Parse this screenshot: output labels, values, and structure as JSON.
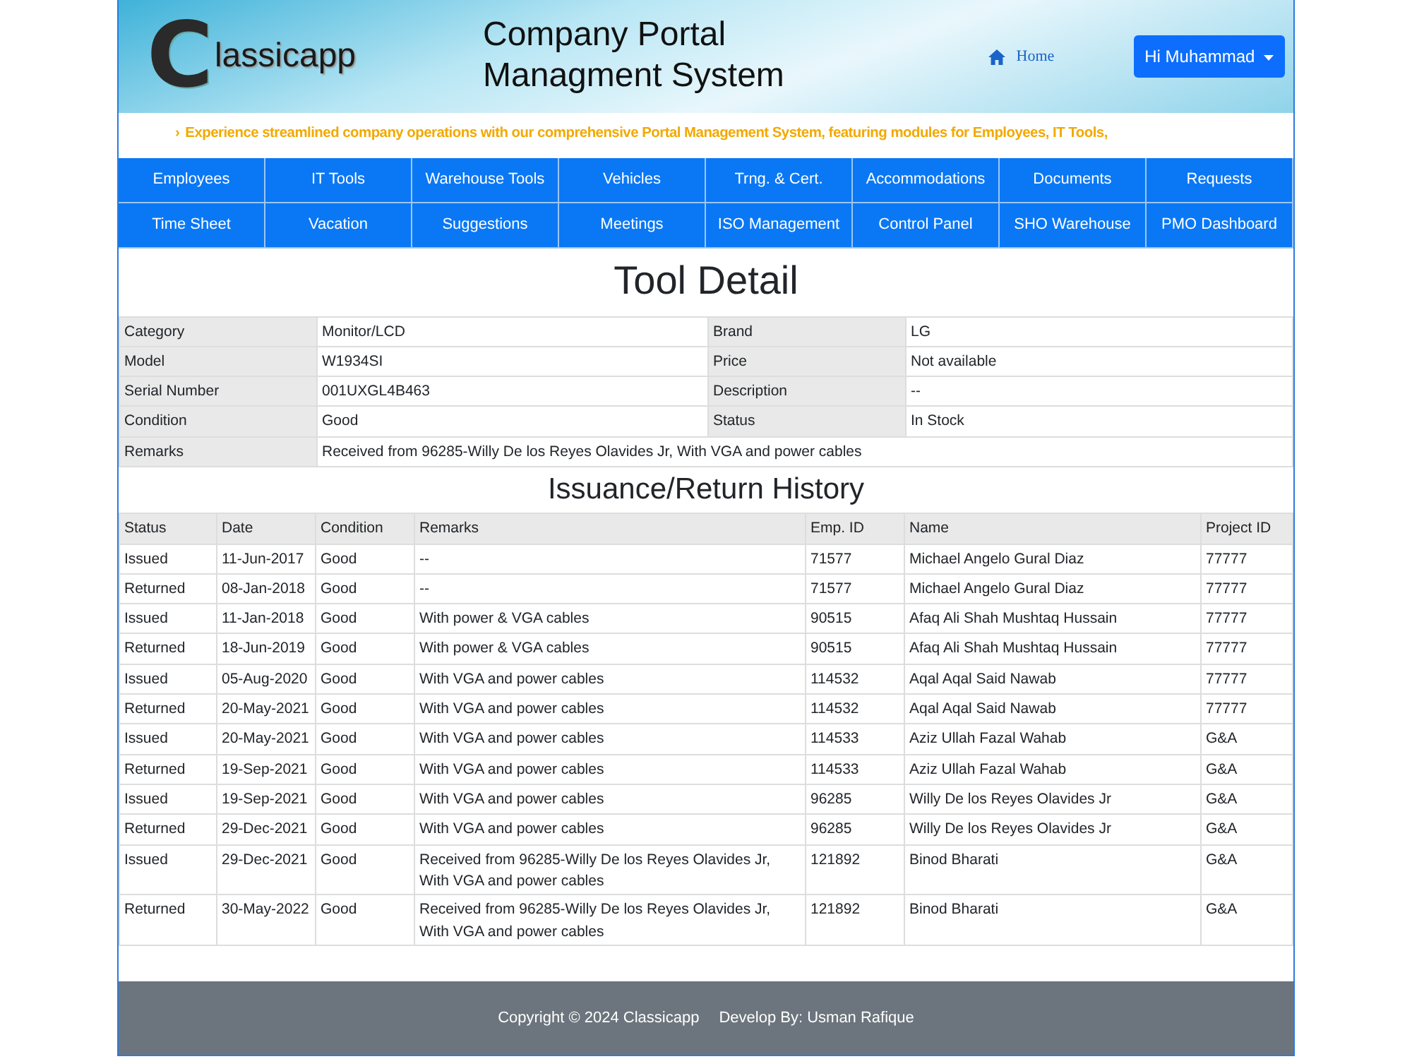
{
  "header": {
    "logo": {
      "initial": "C",
      "rest": "lassicapp"
    },
    "title_lines": [
      "Company Portal",
      "Managment System"
    ],
    "home_link": "Home",
    "user_menu": "Hi Muhammad"
  },
  "ticker": {
    "arrow": "›",
    "text": "Experience streamlined company operations with our comprehensive Portal Management System, featuring modules for Employees, IT Tools,"
  },
  "nav_rows": [
    [
      "Employees",
      "IT Tools",
      "Warehouse Tools",
      "Vehicles",
      "Trng. & Cert.",
      "Accommodations",
      "Documents",
      "Requests"
    ],
    [
      "Time Sheet",
      "Vacation",
      "Suggestions",
      "Meetings",
      "ISO Management",
      "Control Panel",
      "SHO Warehouse",
      "PMO Dashboard"
    ]
  ],
  "page_title": "Tool Detail",
  "details": [
    {
      "label": "Category",
      "value": "Monitor/LCD",
      "label_2": "Brand",
      "value_2": "LG"
    },
    {
      "label": "Model",
      "value": "W1934SI",
      "label_2": "Price",
      "value_2": "Not available"
    },
    {
      "label": "Serial Number",
      "value": "001UXGL4B463",
      "label_2": "Description",
      "value_2": "--"
    },
    {
      "label": "Condition",
      "value": "Good",
      "label_2": "Status",
      "value_2": "In Stock"
    },
    {
      "label": "Remarks",
      "value": "Received from 96285-Willy De los Reyes Olavides Jr, With VGA and power cables"
    }
  ],
  "history_title": "Issuance/Return History",
  "history": {
    "columns": [
      "Status",
      "Date",
      "Condition",
      "Remarks",
      "Emp. ID",
      "Name",
      "Project ID"
    ],
    "rows": [
      [
        "Issued",
        "11-Jun-2017",
        "Good",
        "--",
        "71577",
        "Michael Angelo Gural Diaz",
        "77777"
      ],
      [
        "Returned",
        "08-Jan-2018",
        "Good",
        "--",
        "71577",
        "Michael Angelo Gural Diaz",
        "77777"
      ],
      [
        "Issued",
        "11-Jan-2018",
        "Good",
        "With power & VGA cables",
        "90515",
        "Afaq Ali Shah Mushtaq Hussain",
        "77777"
      ],
      [
        "Returned",
        "18-Jun-2019",
        "Good",
        "With power & VGA cables",
        "90515",
        "Afaq Ali Shah Mushtaq Hussain",
        "77777"
      ],
      [
        "Issued",
        "05-Aug-2020",
        "Good",
        "With VGA and power cables",
        "114532",
        "Aqal Aqal Said Nawab",
        "77777"
      ],
      [
        "Returned",
        "20-May-2021",
        "Good",
        "With VGA and power cables",
        "114532",
        "Aqal Aqal Said Nawab",
        "77777"
      ],
      [
        "Issued",
        "20-May-2021",
        "Good",
        "With VGA and power cables",
        "114533",
        "Aziz Ullah Fazal Wahab",
        "G&A"
      ],
      [
        "Returned",
        "19-Sep-2021",
        "Good",
        "With VGA and power cables",
        "114533",
        "Aziz Ullah Fazal Wahab",
        "G&A"
      ],
      [
        "Issued",
        "19-Sep-2021",
        "Good",
        "With VGA and power cables",
        "96285",
        "Willy De los Reyes Olavides Jr",
        "G&A"
      ],
      [
        "Returned",
        "29-Dec-2021",
        "Good",
        "With VGA and power cables",
        "96285",
        "Willy De los Reyes Olavides Jr",
        "G&A"
      ],
      [
        "Issued",
        "29-Dec-2021",
        "Good",
        "Received from 96285-Willy De los Reyes Olavides Jr, With VGA and power cables",
        "121892",
        "Binod Bharati",
        "G&A"
      ],
      [
        "Returned",
        "30-May-2022",
        "Good",
        "Received from 96285-Willy De los Reyes Olavides Jr, With VGA and power cables",
        "121892",
        "Binod Bharati",
        "G&A"
      ]
    ]
  },
  "footer": {
    "copyright": "Copyright © 2024 Classicapp",
    "developer": "Develop By:  Usman Rafique"
  }
}
